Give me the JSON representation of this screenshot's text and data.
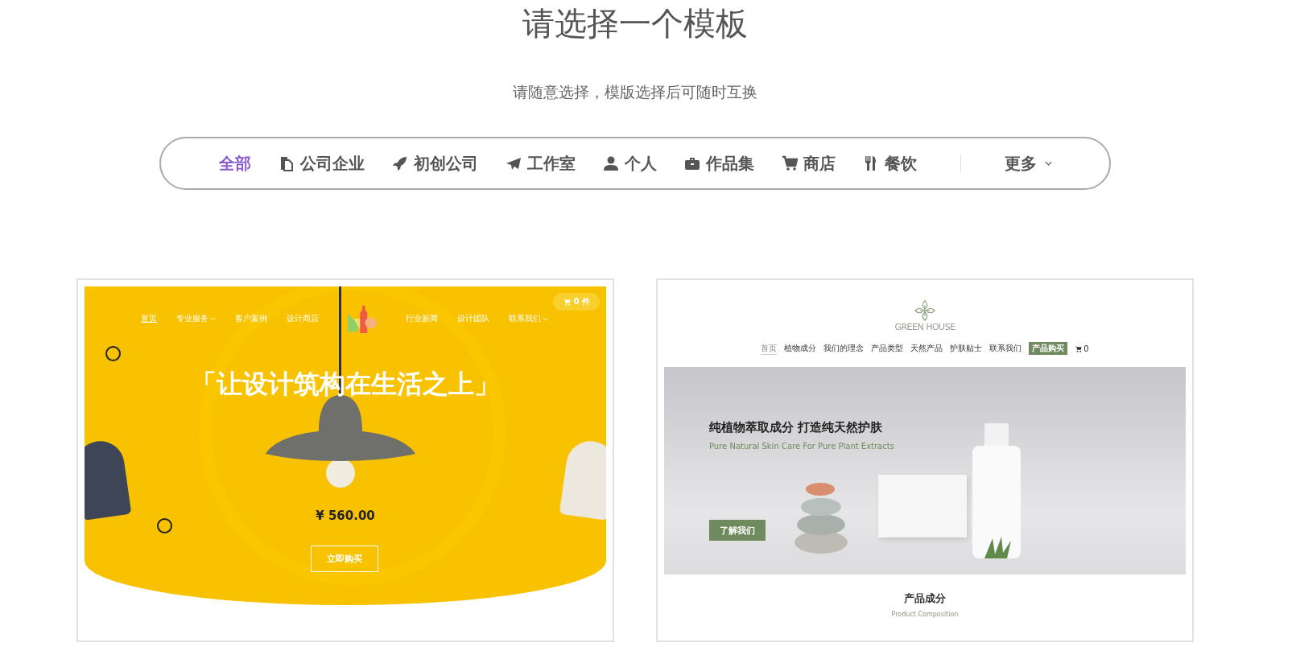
{
  "title": "请选择一个模板",
  "subtitle": "请随意选择，模版选择后可随时互换",
  "categories": [
    {
      "label": "全部",
      "selected": true,
      "kind": "plain"
    },
    {
      "label": "公司企业",
      "selected": false,
      "kind": "company"
    },
    {
      "label": "初创公司",
      "selected": false,
      "kind": "startup"
    },
    {
      "label": "工作室",
      "selected": false,
      "kind": "studio"
    },
    {
      "label": "个人",
      "selected": false,
      "kind": "personal"
    },
    {
      "label": "作品集",
      "selected": false,
      "kind": "portfolio"
    },
    {
      "label": "商店",
      "selected": false,
      "kind": "shop"
    },
    {
      "label": "餐饮",
      "selected": false,
      "kind": "dining"
    }
  ],
  "more": "更多",
  "templates": [
    {
      "kind": "yellow",
      "nav_left": [
        {
          "label": "首页",
          "selected": true,
          "dropdown": false
        },
        {
          "label": "专业服务",
          "selected": false,
          "dropdown": true
        },
        {
          "label": "客户案例",
          "selected": false,
          "dropdown": false
        },
        {
          "label": "设计商店",
          "selected": false,
          "dropdown": false
        }
      ],
      "nav_right": [
        {
          "label": "行业新闻",
          "selected": false,
          "dropdown": false
        },
        {
          "label": "设计团队",
          "selected": false,
          "dropdown": false
        },
        {
          "label": "联系我们",
          "selected": false,
          "dropdown": true
        }
      ],
      "cart": "0 件",
      "headline": "「让设计筑构在生活之上」",
      "price": "¥ 560.00",
      "button": "立即购买"
    },
    {
      "kind": "green",
      "brand": "GREEN HOUSE",
      "nav": [
        {
          "label": "首页",
          "selected": true,
          "kind": "link"
        },
        {
          "label": "植物成分",
          "selected": false,
          "kind": "link"
        },
        {
          "label": "我们的理念",
          "selected": false,
          "kind": "link"
        },
        {
          "label": "产品类型",
          "selected": false,
          "kind": "link"
        },
        {
          "label": "天然产品",
          "selected": false,
          "kind": "link"
        },
        {
          "label": "护肤贴士",
          "selected": false,
          "kind": "link"
        },
        {
          "label": "联系我们",
          "selected": false,
          "kind": "link"
        },
        {
          "label": "产品购买",
          "selected": false,
          "kind": "button"
        }
      ],
      "cart": "0",
      "headline": "纯植物萃取成分 打造纯天然护肤",
      "tagline": "Pure Natural Skin Care For Pure Plant Extracts",
      "button": "了解我们",
      "section_title": "产品成分",
      "section_subtitle": "Product Composition"
    }
  ]
}
